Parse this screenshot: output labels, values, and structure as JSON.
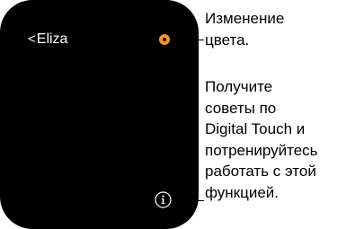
{
  "watch": {
    "back_chevron": "<",
    "back_label": "Eliza",
    "color_accent": "#f79420"
  },
  "callouts": {
    "color_change": {
      "lines": [
        "Изменение",
        "цвета."
      ]
    },
    "info_tips": {
      "lines": [
        "Получите",
        "советы по",
        "Digital Touch и",
        "потренируйтесь",
        "работать с этой",
        "функцией."
      ]
    }
  }
}
